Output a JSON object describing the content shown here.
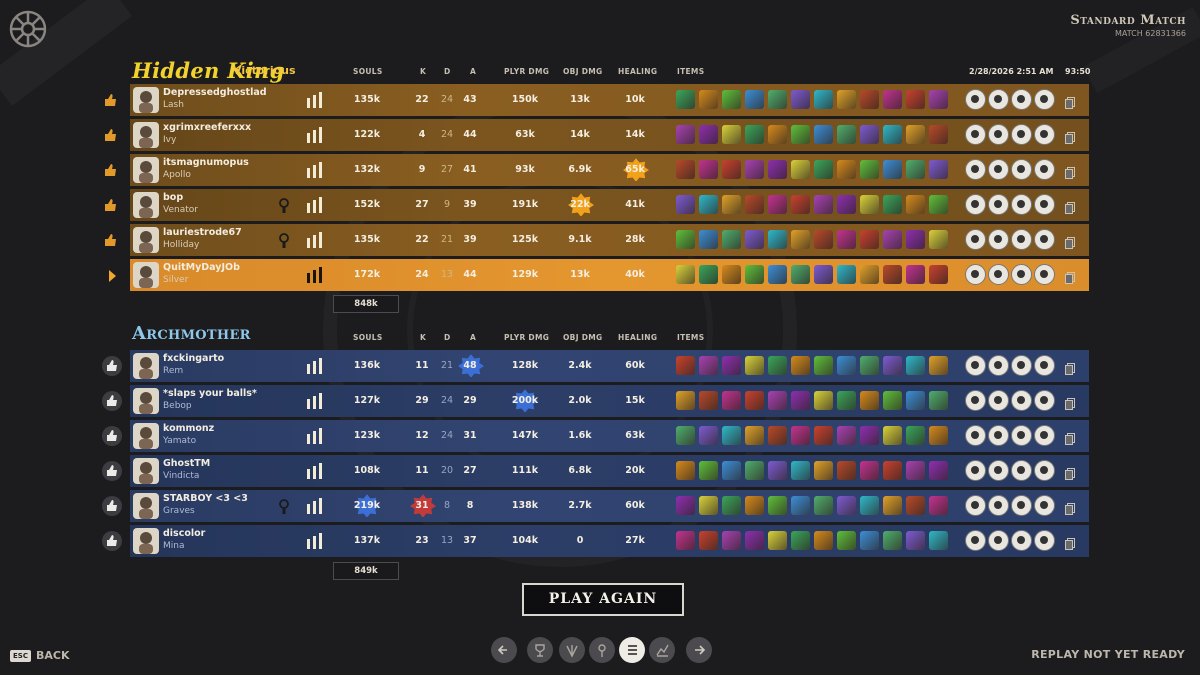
{
  "match": {
    "type": "Standard Match",
    "id": "MATCH 62831366",
    "date": "2/28/2026 2:51 AM",
    "duration": "93:50"
  },
  "columns": {
    "souls": "SOULS",
    "k": "K",
    "d": "D",
    "a": "A",
    "plyr_dmg": "PLYR DMG",
    "obj_dmg": "OBJ DMG",
    "healing": "HEALING",
    "items": "ITEMS"
  },
  "team1": {
    "name": "Hidden King",
    "result": "Victorious",
    "total_souls": "848k",
    "players": [
      {
        "name": "Depressedghostlad",
        "hero": "Lash",
        "souls": "135k",
        "k": "22",
        "d": "24",
        "a": "43",
        "pd": "150k",
        "od": "13k",
        "heal": "10k"
      },
      {
        "name": "xgrimxreeferxxx",
        "hero": "Ivy",
        "souls": "122k",
        "k": "4",
        "d": "24",
        "a": "44",
        "pd": "63k",
        "od": "14k",
        "heal": "14k"
      },
      {
        "name": "itsmagnumopus",
        "hero": "Apollo",
        "souls": "132k",
        "k": "9",
        "d": "27",
        "a": "41",
        "pd": "93k",
        "od": "6.9k",
        "heal": "65k"
      },
      {
        "name": "bop",
        "hero": "Venator",
        "souls": "152k",
        "k": "27",
        "d": "9",
        "a": "39",
        "pd": "191k",
        "od": "22k",
        "heal": "41k"
      },
      {
        "name": "lauriestrode67",
        "hero": "Holliday",
        "souls": "135k",
        "k": "22",
        "d": "21",
        "a": "39",
        "pd": "125k",
        "od": "9.1k",
        "heal": "28k"
      },
      {
        "name": "QuitMyDayJOb",
        "hero": "Silver",
        "souls": "172k",
        "k": "24",
        "d": "13",
        "a": "44",
        "pd": "129k",
        "od": "13k",
        "heal": "40k"
      }
    ]
  },
  "team2": {
    "name": "Archmother",
    "total_souls": "849k",
    "players": [
      {
        "name": "fxckingarto",
        "hero": "Rem",
        "souls": "136k",
        "k": "11",
        "d": "21",
        "a": "48",
        "pd": "128k",
        "od": "2.4k",
        "heal": "60k"
      },
      {
        "name": "*slaps your balls*",
        "hero": "Bebop",
        "souls": "127k",
        "k": "29",
        "d": "24",
        "a": "29",
        "pd": "200k",
        "od": "2.0k",
        "heal": "15k"
      },
      {
        "name": "kommonz",
        "hero": "Yamato",
        "souls": "123k",
        "k": "12",
        "d": "24",
        "a": "31",
        "pd": "147k",
        "od": "1.6k",
        "heal": "63k"
      },
      {
        "name": "GhostTM",
        "hero": "Vindicta",
        "souls": "108k",
        "k": "11",
        "d": "20",
        "a": "27",
        "pd": "111k",
        "od": "6.8k",
        "heal": "20k"
      },
      {
        "name": "STARBOY <3 <3",
        "hero": "Graves",
        "souls": "219k",
        "k": "31",
        "d": "8",
        "a": "8",
        "pd": "138k",
        "od": "2.7k",
        "heal": "60k"
      },
      {
        "name": "discolor",
        "hero": "Mina",
        "souls": "137k",
        "k": "23",
        "d": "13",
        "a": "37",
        "pd": "104k",
        "od": "0",
        "heal": "27k"
      }
    ]
  },
  "buttons": {
    "play_again": "PLAY AGAIN",
    "back": "BACK",
    "esc": "ESC"
  },
  "status": {
    "replay": "REPLAY NOT YET READY"
  },
  "colors": {
    "gold_row": "#7f5620",
    "self_row": "#e4962f",
    "blue_row": "#324572",
    "highlight_burst": "#f2a21a",
    "blue_burst": "#3c6fd6"
  }
}
